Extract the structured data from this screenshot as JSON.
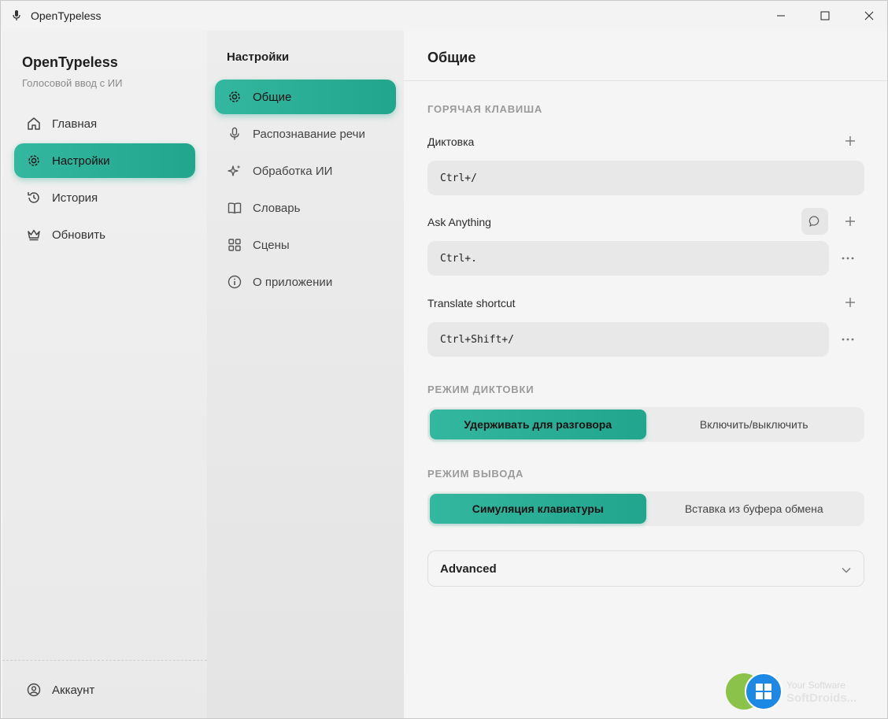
{
  "window": {
    "title": "OpenTypeless"
  },
  "sidebar": {
    "brand": "OpenTypeless",
    "subtitle": "Голосовой ввод с ИИ",
    "items": [
      {
        "label": "Главная",
        "icon": "home-icon",
        "active": false
      },
      {
        "label": "Настройки",
        "icon": "gear-icon",
        "active": true
      },
      {
        "label": "История",
        "icon": "history-icon",
        "active": false
      },
      {
        "label": "Обновить",
        "icon": "crown-icon",
        "active": false
      }
    ],
    "account": "Аккаунт"
  },
  "settings_nav": {
    "title": "Настройки",
    "items": [
      {
        "label": "Общие",
        "icon": "gear-icon",
        "active": true
      },
      {
        "label": "Распознавание речи",
        "icon": "microphone-icon",
        "active": false
      },
      {
        "label": "Обработка ИИ",
        "icon": "sparkles-icon",
        "active": false
      },
      {
        "label": "Словарь",
        "icon": "book-icon",
        "active": false
      },
      {
        "label": "Сцены",
        "icon": "grid-icon",
        "active": false
      },
      {
        "label": "О приложении",
        "icon": "info-icon",
        "active": false
      }
    ]
  },
  "main": {
    "title": "Общие",
    "hotkey_section": "Горячая клавиша",
    "dictation_label": "Диктовка",
    "dictation_value": "Ctrl+/",
    "ask_label": "Ask Anything",
    "ask_value": "Ctrl+.",
    "translate_label": "Translate shortcut",
    "translate_value": "Ctrl+Shift+/",
    "dictation_mode_section": "Режим диктовки",
    "dictation_mode_options": [
      "Удерживать для разговора",
      "Включить/выключить"
    ],
    "output_mode_section": "Режим вывода",
    "output_mode_options": [
      "Симуляция клавиатуры",
      "Вставка из буфера обмена"
    ],
    "advanced_label": "Advanced"
  },
  "watermark": {
    "line1": "Your Software",
    "line2": "SoftDroids..."
  },
  "colors": {
    "accent": "#2bb199",
    "background": "#f5f5f5"
  }
}
